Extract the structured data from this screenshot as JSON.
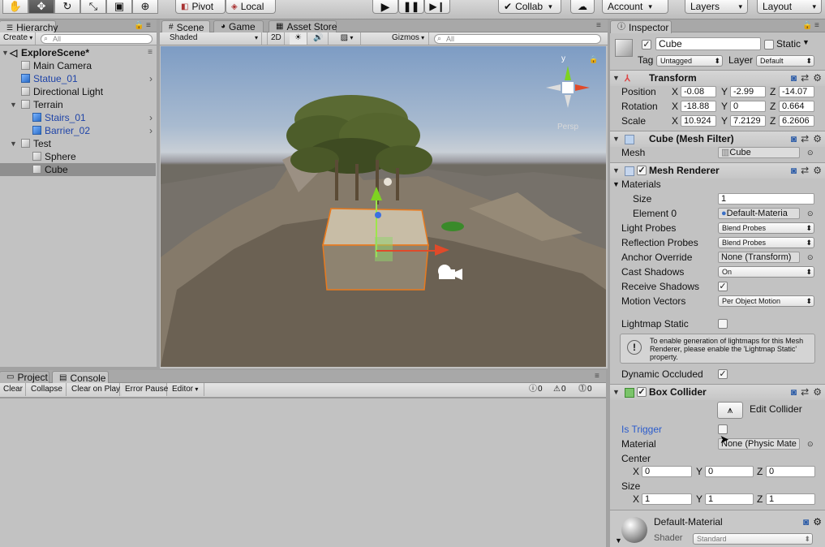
{
  "toolbar": {
    "tools": [
      "hand-icon",
      "move-icon",
      "rotate-icon",
      "scale-icon",
      "rect-icon",
      "transform-icon"
    ],
    "pivot_label": "Pivot",
    "local_label": "Local",
    "collab_label": "Collab",
    "account_label": "Account",
    "layers_label": "Layers",
    "layout_label": "Layout"
  },
  "hierarchy": {
    "tab": "Hierarchy",
    "create_label": "Create",
    "search_placeholder": "All",
    "scene_name": "ExploreScene*",
    "items": [
      {
        "label": "Main Camera"
      },
      {
        "label": "Statue_01"
      },
      {
        "label": "Directional Light"
      },
      {
        "label": "Terrain"
      },
      {
        "label": "Stairs_01"
      },
      {
        "label": "Barrier_02"
      },
      {
        "label": "Test"
      },
      {
        "label": "Sphere"
      },
      {
        "label": "Cube"
      }
    ]
  },
  "scene": {
    "tabs": [
      "Scene",
      "Game",
      "Asset Store"
    ],
    "shading_mode": "Shaded",
    "mode_2d": "2D",
    "gizmos_label": "Gizmos",
    "search_placeholder": "All",
    "gizmo_y_label": "y",
    "persp_label": "Persp"
  },
  "console": {
    "tabs": [
      "Project",
      "Console"
    ],
    "buttons": [
      "Clear",
      "Collapse",
      "Clear on Play",
      "Error Pause",
      "Editor"
    ],
    "counts": {
      "info": "0",
      "warnings": "0",
      "errors": "0"
    }
  },
  "inspector": {
    "tab": "Inspector",
    "object_name": "Cube",
    "static_label": "Static",
    "tag_label": "Tag",
    "tag_value": "Untagged",
    "layer_label": "Layer",
    "layer_value": "Default",
    "transform": {
      "title": "Transform",
      "position_label": "Position",
      "rotation_label": "Rotation",
      "scale_label": "Scale",
      "position": {
        "x": "-0.08",
        "y": "-2.99",
        "z": "-14.07"
      },
      "rotation": {
        "x": "-18.88",
        "y": "0",
        "z": "0.664"
      },
      "scale": {
        "x": "10.924",
        "y": "7.2129",
        "z": "6.2606"
      }
    },
    "mesh_filter": {
      "title": "Cube (Mesh Filter)",
      "mesh_label": "Mesh",
      "mesh_value": "Cube"
    },
    "mesh_renderer": {
      "title": "Mesh Renderer",
      "materials_label": "Materials",
      "size_label": "Size",
      "size_value": "1",
      "element0_label": "Element 0",
      "element0_value": "Default-Materia",
      "light_probes_label": "Light Probes",
      "light_probes_value": "Blend Probes",
      "reflection_probes_label": "Reflection Probes",
      "reflection_probes_value": "Blend Probes",
      "anchor_override_label": "Anchor Override",
      "anchor_override_value": "None (Transform)",
      "cast_shadows_label": "Cast Shadows",
      "cast_shadows_value": "On",
      "receive_shadows_label": "Receive Shadows",
      "motion_vectors_label": "Motion Vectors",
      "motion_vectors_value": "Per Object Motion",
      "lightmap_static_label": "Lightmap Static",
      "info_text": "To enable generation of lightmaps for this Mesh Renderer, please enable the 'Lightmap Static' property.",
      "dynamic_occluded_label": "Dynamic Occluded"
    },
    "box_collider": {
      "title": "Box Collider",
      "edit_collider_label": "Edit Collider",
      "is_trigger_label": "Is Trigger",
      "material_label": "Material",
      "material_value": "None (Physic Mate",
      "center_label": "Center",
      "center": {
        "x": "0",
        "y": "0",
        "z": "0"
      },
      "size_label": "Size",
      "size": {
        "x": "1",
        "y": "1",
        "z": "1"
      }
    },
    "material": {
      "title": "Default-Material",
      "shader_label": "Shader",
      "shader_value": "Standard"
    }
  }
}
